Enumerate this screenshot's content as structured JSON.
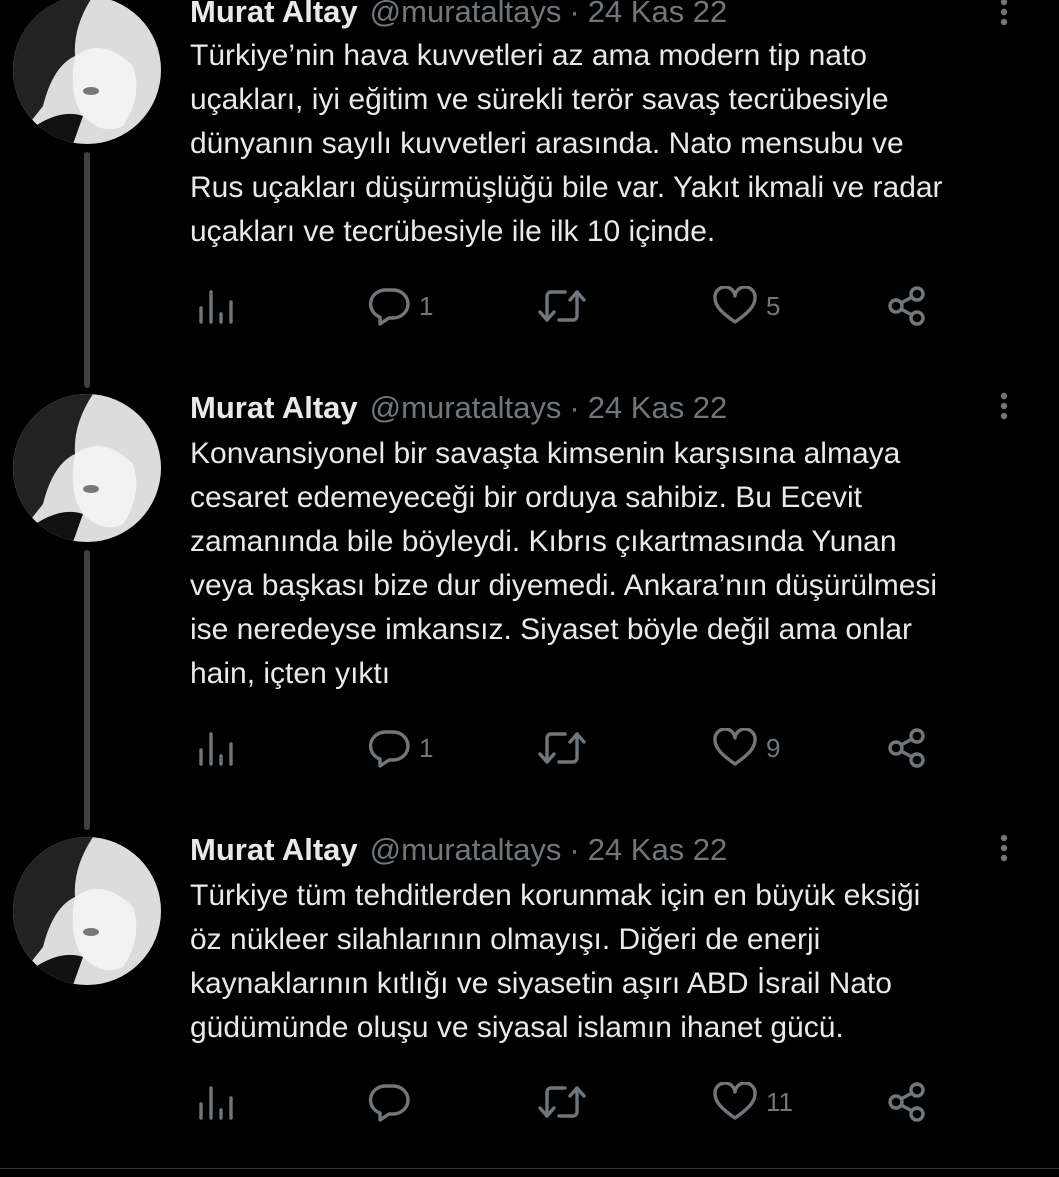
{
  "tweets": [
    {
      "name": "Murat Altay",
      "handle": "@murataltays",
      "separator": "·",
      "date": "24 Kas 22",
      "text": "Türkiye’nin hava kuvvetleri az ama modern tip nato\nuçakları, iyi eğitim ve sürekli terör savaş tecrübesiyle\ndünyanın sayılı kuvvetleri arasında. Nato mensubu ve\nRus uçakları düşürmüşlüğü bile var. Yakıt ikmali ve radar\nuçakları ve tecrübesiyle ile ilk 10 içinde.",
      "replies": "1",
      "retweets": "",
      "likes": "5"
    },
    {
      "name": "Murat Altay",
      "handle": "@murataltays",
      "separator": "·",
      "date": "24 Kas 22",
      "text": "Konvansiyonel bir savaşta kimsenin karşısına almaya\ncesaret edemeyeceği bir orduya sahibiz. Bu Ecevit\nzamanında bile böyleydi. Kıbrıs çıkartmasında Yunan\nveya başkası bize dur diyemedi. Ankara’nın düşürülmesi\nise neredeyse imkansız. Siyaset böyle değil ama onlar\nhain, içten yıktı",
      "replies": "1",
      "retweets": "",
      "likes": "9"
    },
    {
      "name": "Murat Altay",
      "handle": "@murataltays",
      "separator": "·",
      "date": "24 Kas 22",
      "text": "Türkiye tüm tehditlerden korunmak için en büyük eksiği\nöz nükleer silahlarının olmayışı. Diğeri de enerji\nkaynaklarının kıtlığı ve siyasetin aşırı ABD İsrail Nato\ngüdümünde oluşu ve siyasal islamın ihanet gücü.",
      "replies": "",
      "retweets": "",
      "likes": "11"
    }
  ],
  "icons": {
    "views": "views-icon",
    "reply": "reply-icon",
    "retweet": "retweet-icon",
    "like": "like-icon",
    "share": "share-icon",
    "more": "more-icon"
  },
  "colors": {
    "background": "#000000",
    "text": "#e7e9ea",
    "secondary": "#71767b",
    "thread_line": "#3e4144"
  }
}
